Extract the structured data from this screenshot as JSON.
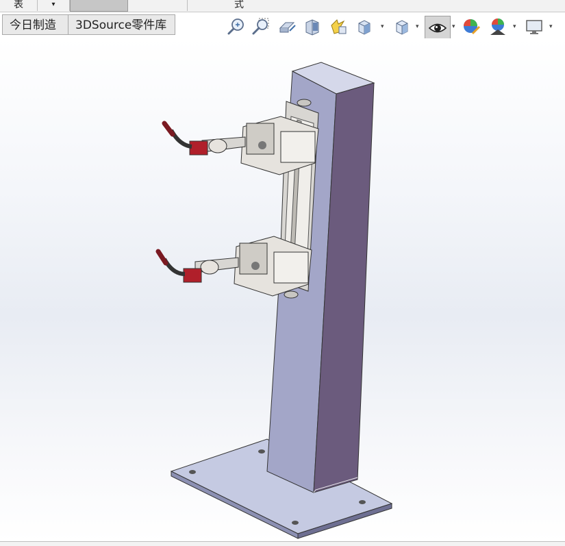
{
  "top_strip": {
    "left_label": "表",
    "dropdown_glyph": "▾",
    "center_label": "式"
  },
  "tabs": [
    {
      "label": "今日制造"
    },
    {
      "label": "3DSource零件库"
    }
  ],
  "toolbar": {
    "icons": [
      "zoom-to-fit-icon",
      "zoom-to-area-icon",
      "previous-view-icon",
      "section-view-icon",
      "dynamic-annotation-view-icon",
      "view-orientation-icon",
      "display-style-icon",
      "hide-show-items-icon",
      "edit-appearance-icon",
      "apply-scene-icon",
      "view-settings-icon"
    ],
    "dropdown_glyph": "▾"
  },
  "model": {
    "colors": {
      "plate": "#c4c9e0",
      "column_front": "#a6a9c9",
      "column_side": "#6a5a7c",
      "column_top": "#d6d8ea",
      "accent_red": "#b0222b",
      "metal": "#d9d7d3"
    }
  }
}
